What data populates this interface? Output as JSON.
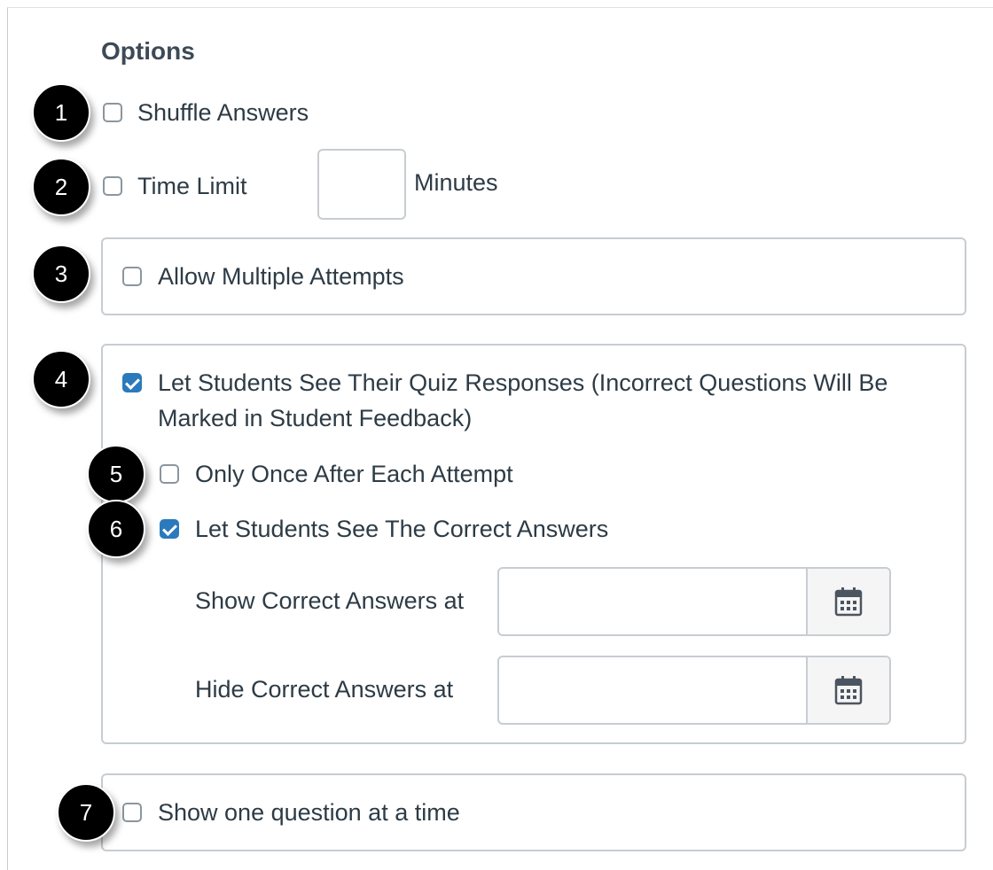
{
  "options": {
    "title": "Options",
    "shuffle_answers": {
      "label": "Shuffle Answers",
      "checked": false
    },
    "time_limit": {
      "label": "Time Limit",
      "unit": "Minutes",
      "value": "",
      "checked": false
    },
    "allow_multiple_attempts": {
      "label": "Allow Multiple Attempts",
      "checked": false
    },
    "see_responses": {
      "label": "Let Students See Their Quiz Responses (Incorrect Questions Will Be Marked in Student Feedback)",
      "checked": true
    },
    "only_once": {
      "label": "Only Once After Each Attempt",
      "checked": false
    },
    "see_correct": {
      "label": "Let Students See The Correct Answers",
      "checked": true
    },
    "show_correct_at": {
      "label": "Show Correct Answers at",
      "value": ""
    },
    "hide_correct_at": {
      "label": "Hide Correct Answers at",
      "value": ""
    },
    "one_question": {
      "label": "Show one question at a time",
      "checked": false
    }
  },
  "callouts": [
    "1",
    "2",
    "3",
    "4",
    "5",
    "6",
    "7"
  ],
  "icons": {
    "date_picker": "calendar-icon"
  },
  "colors": {
    "checked": "#2b7abc",
    "callout": "#000000",
    "border": "#c7cdd1",
    "text": "#2d3b45"
  }
}
